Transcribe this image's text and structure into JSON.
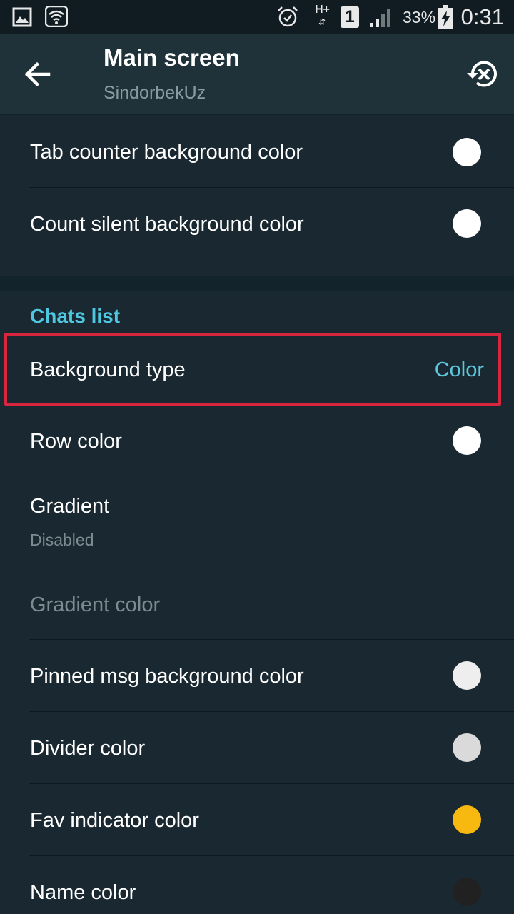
{
  "status_bar": {
    "network": "H+",
    "sim": "1",
    "battery": "33%",
    "time": "0:31",
    "icons": [
      "gallery-icon",
      "wifi-icon",
      "alarm-icon",
      "network-hplus-icon",
      "sim-icon",
      "signal-icon",
      "battery-charging-icon"
    ]
  },
  "header": {
    "title": "Main screen",
    "subtitle": "SindorbekUz",
    "back_icon": "arrow-left-icon",
    "reset_icon": "restore-icon"
  },
  "rows_top": [
    {
      "label": "Tab counter background color",
      "swatch": "#ffffff"
    },
    {
      "label": "Count silent background color",
      "swatch": "#ffffff"
    }
  ],
  "section": {
    "title": "Chats list"
  },
  "background_type": {
    "label": "Background type",
    "value": "Color"
  },
  "row_color": {
    "label": "Row color",
    "swatch": "#ffffff"
  },
  "gradient": {
    "label": "Gradient",
    "value": "Disabled"
  },
  "gradient_color": {
    "label": "Gradient color"
  },
  "rows_bottom": [
    {
      "label": "Pinned msg background color",
      "swatch": "#eeeeee"
    },
    {
      "label": "Divider color",
      "swatch": "#dadada"
    },
    {
      "label": "Fav indicator color",
      "swatch": "#f7b90f"
    },
    {
      "label": "Name color",
      "swatch": "#212121"
    }
  ],
  "colors": {
    "accent": "#4fc7e1",
    "highlight": "#d7263d",
    "background": "#1a2931",
    "header": "#1f3239"
  }
}
